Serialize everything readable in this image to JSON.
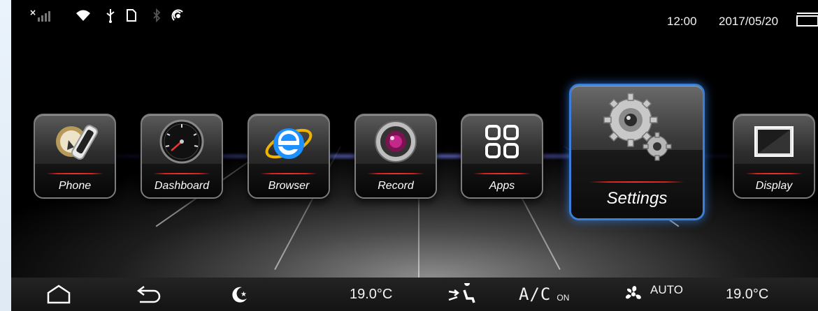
{
  "status_bar": {
    "time": "12:00",
    "date": "2017/05/20",
    "icons": [
      "no-signal-icon",
      "wifi-icon",
      "usb-icon",
      "sd-card-icon",
      "bluetooth-icon",
      "hotspot-icon",
      "window-icon"
    ]
  },
  "apps": [
    {
      "label": "Phone",
      "icon": "phone-icon"
    },
    {
      "label": "Dashboard",
      "icon": "speedometer-icon"
    },
    {
      "label": "Browser",
      "icon": "internet-explorer-icon"
    },
    {
      "label": "Record",
      "icon": "camera-lens-icon"
    },
    {
      "label": "Apps",
      "icon": "app-grid-icon"
    },
    {
      "label": "Settings",
      "icon": "gears-icon",
      "selected": true
    },
    {
      "label": "Display",
      "icon": "display-icon"
    }
  ],
  "bottom_bar": {
    "left_temp": "19.0°C",
    "ac_label": "A/C",
    "ac_state": "ON",
    "fan_mode": "AUTO",
    "right_temp": "19.0°C"
  },
  "colors": {
    "accent_red": "#e63333",
    "selection_blue": "#3b7fd6",
    "browser_blue": "#1e90ff",
    "background": "#000000"
  }
}
